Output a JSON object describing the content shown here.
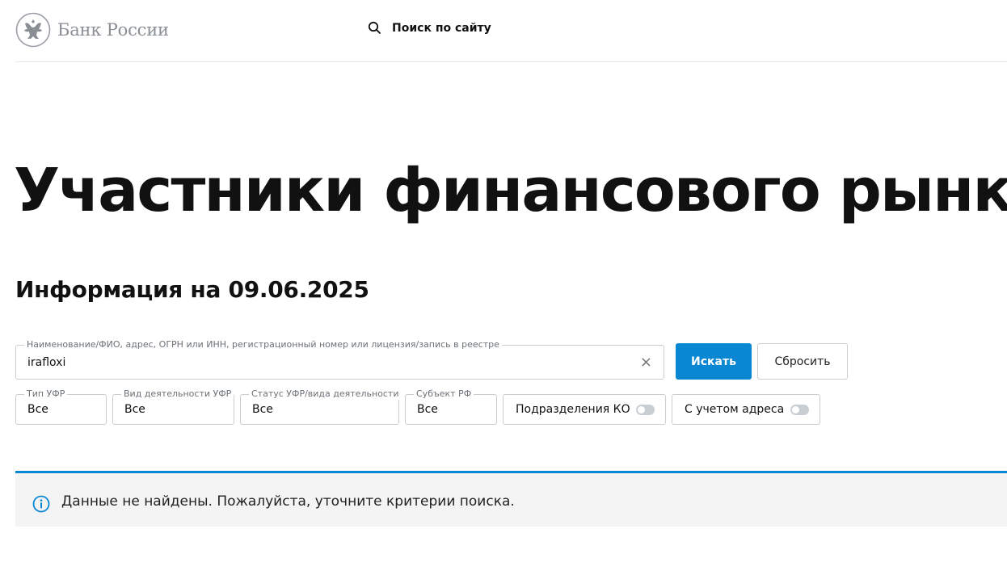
{
  "header": {
    "logo_text": "Банк России",
    "search_label": "Поиск по сайту"
  },
  "page": {
    "title": "Участники финансового рынка",
    "subtitle": "Информация на 09.06.2025"
  },
  "search": {
    "legend": "Наименование/ФИО, адрес, ОГРН или ИНН, регистрационный номер или лицензия/запись в реестре",
    "value": "irafloxi",
    "clear_glyph": "×",
    "submit_label": "Искать",
    "reset_label": "Сбросить"
  },
  "filters": {
    "type": {
      "legend": "Тип УФР",
      "value": "Все"
    },
    "activity": {
      "legend": "Вид деятельности УФР",
      "value": "Все"
    },
    "status": {
      "legend": "Статус УФР/вида деятельности",
      "value": "Все"
    },
    "region": {
      "legend": "Субъект РФ",
      "value": "Все"
    },
    "branches_toggle": {
      "label": "Подразделения КО",
      "checked": false
    },
    "address_toggle": {
      "label": "С учетом адреса",
      "checked": false
    }
  },
  "alert": {
    "text": "Данные не найдены. Пожалуйста, уточните критерии поиска."
  },
  "colors": {
    "accent": "#0a87d2",
    "logo_gray": "#8a8f95",
    "border": "#c9ced3",
    "alert_bg": "#f4f4f5"
  },
  "icons": {
    "logo": "double-headed-eagle-emblem",
    "search": "magnifier-icon",
    "clear": "close-icon",
    "info": "info-circle-icon"
  }
}
